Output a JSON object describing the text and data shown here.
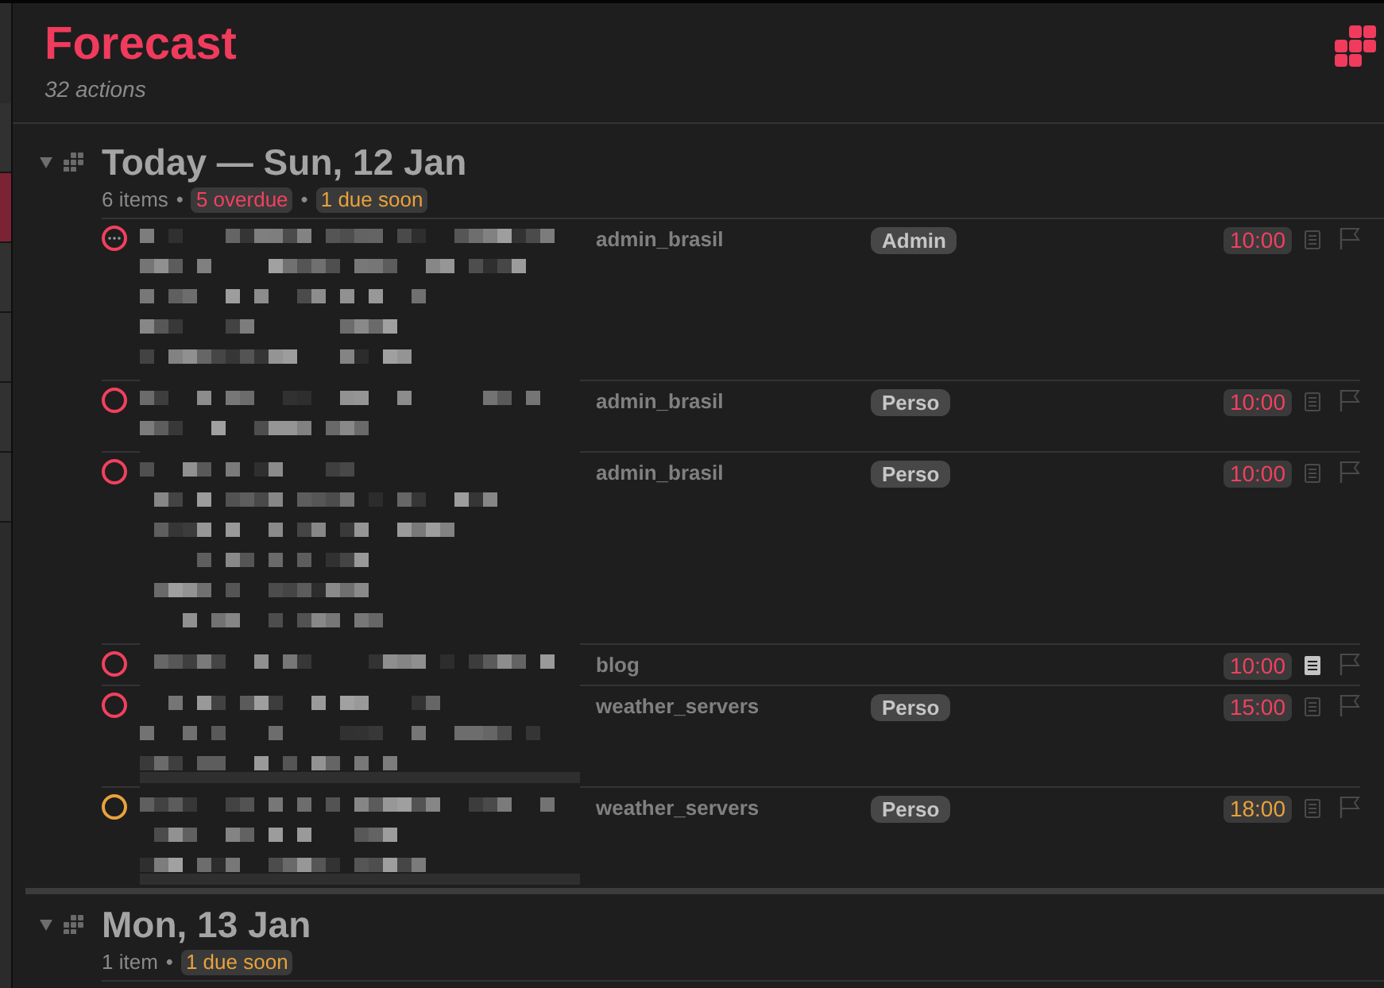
{
  "sidebar": {
    "items": [
      {
        "selected": false
      },
      {
        "selected": true
      },
      {
        "selected": false
      },
      {
        "selected": false
      },
      {
        "selected": false
      },
      {
        "selected": false
      }
    ]
  },
  "header": {
    "title": "Forecast",
    "subtitle": "32 actions"
  },
  "groups": [
    {
      "title": "Today — Sun, 12 Jan",
      "expanded": true,
      "summary": [
        {
          "kind": "count",
          "text": "6 items"
        },
        {
          "kind": "separator",
          "text": "•"
        },
        {
          "kind": "overdue",
          "text": "5 overdue"
        },
        {
          "kind": "separator",
          "text": "•"
        },
        {
          "kind": "due_soon",
          "text": "1 due soon"
        }
      ],
      "items": [
        {
          "overdue": true,
          "ellipsis": true,
          "project": "admin_brasil",
          "tag": "Admin",
          "time": "10:00",
          "has_note": false,
          "flagged": false
        },
        {
          "overdue": true,
          "ellipsis": false,
          "project": "admin_brasil",
          "tag": "Perso",
          "time": "10:00",
          "has_note": false,
          "flagged": false
        },
        {
          "overdue": true,
          "ellipsis": false,
          "project": "admin_brasil",
          "tag": "Perso",
          "time": "10:00",
          "has_note": false,
          "flagged": false
        },
        {
          "overdue": true,
          "ellipsis": false,
          "project": "blog",
          "time": "10:00",
          "has_note": true,
          "flagged": false
        },
        {
          "overdue": true,
          "ellipsis": false,
          "project": "weather_servers",
          "tag": "Perso",
          "time": "15:00",
          "has_note": false,
          "flagged": false
        },
        {
          "overdue": false,
          "ellipsis": false,
          "project": "weather_servers",
          "tag": "Perso",
          "time": "18:00",
          "has_note": false,
          "flagged": false
        }
      ]
    },
    {
      "title": "Mon, 13 Jan",
      "expanded": true,
      "summary": [
        {
          "kind": "count",
          "text": "1 item"
        },
        {
          "kind": "separator",
          "text": "•"
        },
        {
          "kind": "due_soon",
          "text": "1 due soon"
        }
      ]
    }
  ]
}
